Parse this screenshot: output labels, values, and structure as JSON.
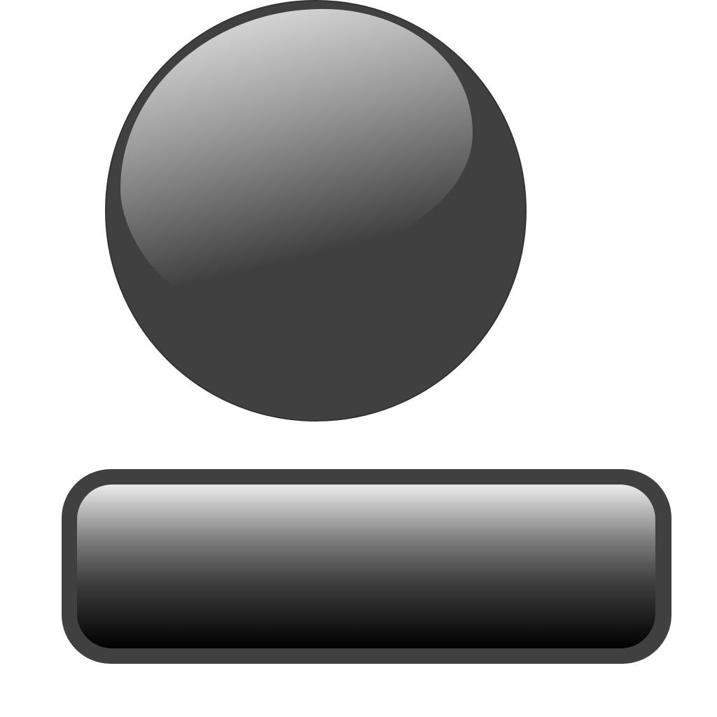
{
  "colors": {
    "background": "#ffffff",
    "body": "#404040",
    "outline": "#3a3a3a",
    "highlight_light": "#dcdcdc",
    "highlight_mid": "#8c8c8c",
    "bar_top": "#ebebeb",
    "bar_bottom": "#000000"
  },
  "shapes": {
    "orb": {
      "name": "glossy-orb"
    },
    "bar": {
      "name": "glossy-bar"
    }
  }
}
